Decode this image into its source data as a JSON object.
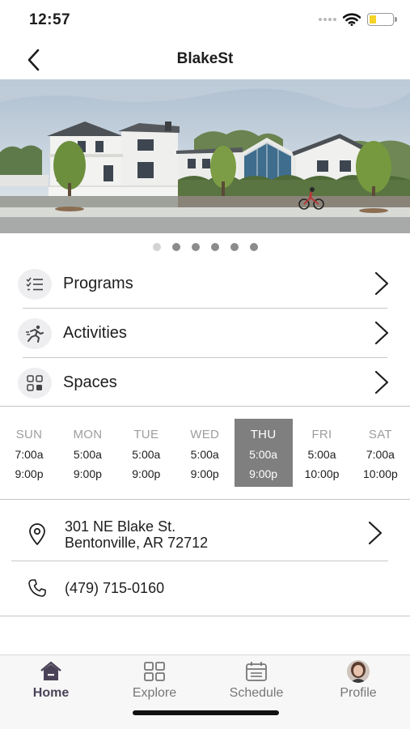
{
  "status_bar": {
    "time": "12:57"
  },
  "nav": {
    "title": "BlakeSt"
  },
  "carousel": {
    "page_count": 6,
    "active_index": 0
  },
  "menu": {
    "items": [
      {
        "label": "Programs",
        "icon": "checklist-icon"
      },
      {
        "label": "Activities",
        "icon": "running-person-icon"
      },
      {
        "label": "Spaces",
        "icon": "grid-icon"
      }
    ]
  },
  "hours": {
    "days": [
      {
        "name": "SUN",
        "open": "7:00a",
        "close": "9:00p",
        "active": false
      },
      {
        "name": "MON",
        "open": "5:00a",
        "close": "9:00p",
        "active": false
      },
      {
        "name": "TUE",
        "open": "5:00a",
        "close": "9:00p",
        "active": false
      },
      {
        "name": "WED",
        "open": "5:00a",
        "close": "9:00p",
        "active": false
      },
      {
        "name": "THU",
        "open": "5:00a",
        "close": "9:00p",
        "active": true
      },
      {
        "name": "FRI",
        "open": "5:00a",
        "close": "10:00p",
        "active": false
      },
      {
        "name": "SAT",
        "open": "7:00a",
        "close": "10:00p",
        "active": false
      }
    ]
  },
  "contact": {
    "address_line1": "301 NE Blake St.",
    "address_line2": "Bentonville, AR 72712",
    "phone": "(479) 715-0160"
  },
  "tabbar": {
    "tabs": [
      {
        "label": "Home",
        "icon": "home-icon",
        "active": true
      },
      {
        "label": "Explore",
        "icon": "explore-grid-icon",
        "active": false
      },
      {
        "label": "Schedule",
        "icon": "calendar-icon",
        "active": false
      },
      {
        "label": "Profile",
        "icon": "avatar",
        "active": false
      }
    ]
  },
  "colors": {
    "accent": "#4a4358",
    "active_day_bg": "#7f7f7f",
    "icon_circle_bg": "#eeedf0",
    "battery_fill": "#f5d327"
  }
}
